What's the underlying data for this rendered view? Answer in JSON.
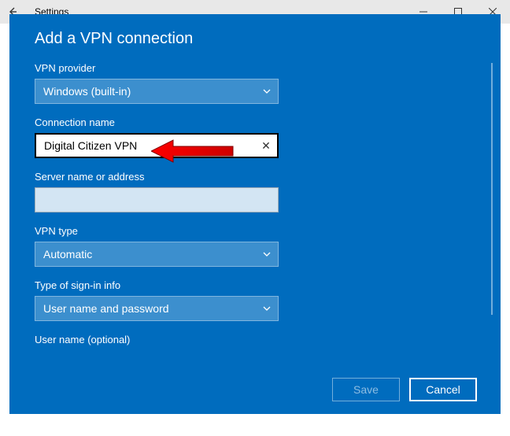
{
  "window": {
    "title": "Settings"
  },
  "dialog": {
    "title": "Add a VPN connection",
    "fields": {
      "provider": {
        "label": "VPN provider",
        "value": "Windows (built-in)"
      },
      "connName": {
        "label": "Connection name",
        "value": "Digital Citizen VPN"
      },
      "server": {
        "label": "Server name or address",
        "value": ""
      },
      "vpnType": {
        "label": "VPN type",
        "value": "Automatic"
      },
      "signin": {
        "label": "Type of sign-in info",
        "value": "User name and password"
      },
      "username": {
        "label": "User name (optional)",
        "value": ""
      }
    },
    "buttons": {
      "save": "Save",
      "cancel": "Cancel"
    }
  }
}
